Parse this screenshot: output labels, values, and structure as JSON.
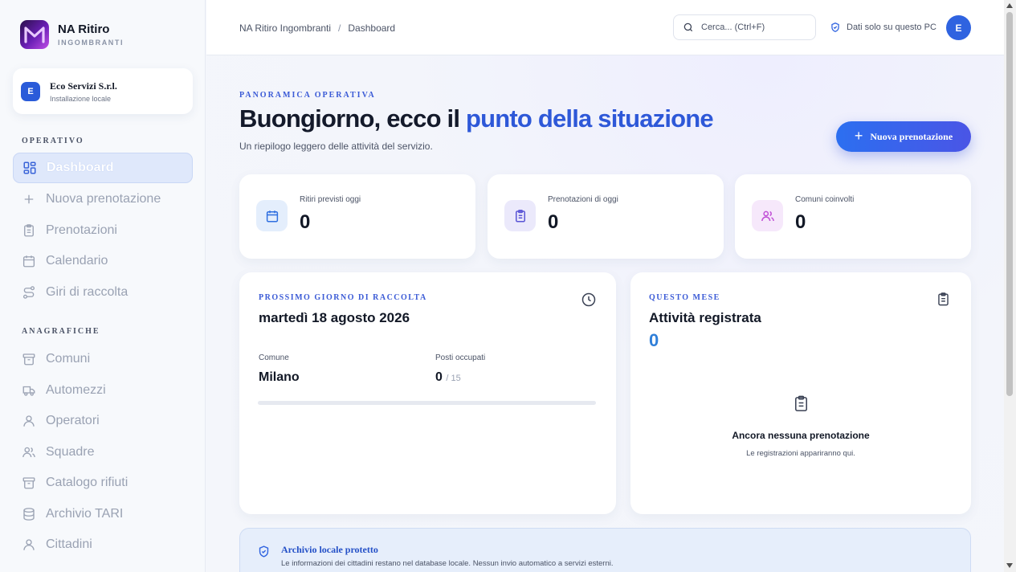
{
  "brand": {
    "title": "NA Ritiro",
    "subtitle": "INGOMBRANTI"
  },
  "org": {
    "avatar": "E",
    "name": "Eco Servizi S.r.l.",
    "subtitle": "Installazione locale"
  },
  "sidebar": {
    "section_operativo": "OPERATIVO",
    "section_anagrafiche": "ANAGRAFICHE",
    "operativo": [
      {
        "label": "Dashboard",
        "icon": "grid-icon",
        "active": true
      },
      {
        "label": "Nuova prenotazione",
        "icon": "plus-icon"
      },
      {
        "label": "Prenotazioni",
        "icon": "clipboard-icon"
      },
      {
        "label": "Calendario",
        "icon": "calendar-icon"
      },
      {
        "label": "Giri di raccolta",
        "icon": "route-icon"
      }
    ],
    "anagrafiche": [
      {
        "label": "Comuni",
        "icon": "archive-icon"
      },
      {
        "label": "Automezzi",
        "icon": "truck-icon"
      },
      {
        "label": "Operatori",
        "icon": "user-icon"
      },
      {
        "label": "Squadre",
        "icon": "users-icon"
      },
      {
        "label": "Catalogo rifiuti",
        "icon": "archive-icon"
      },
      {
        "label": "Archivio TARI",
        "icon": "database-icon"
      },
      {
        "label": "Cittadini",
        "icon": "user-icon"
      }
    ]
  },
  "topbar": {
    "breadcrumb_root": "NA Ritiro Ingombranti",
    "breadcrumb_sep": "/",
    "breadcrumb_current": "Dashboard",
    "search_placeholder": "Cerca... (Ctrl+F)",
    "local_note": "Dati solo su questo PC",
    "user_avatar": "E"
  },
  "hero": {
    "eyebrow": "PANORAMICA OPERATIVA",
    "title_part1": "Buongiorno, ecco il ",
    "title_part2": "punto della situazione",
    "subtitle": "Un riepilogo leggero delle attività del servizio.",
    "cta_plus": "+",
    "cta_label": "Nuova prenotazione"
  },
  "stats": [
    {
      "label": "Ritiri previsti oggi",
      "value": "0",
      "icon": "calendar-icon",
      "color": "#2f6fe0"
    },
    {
      "label": "Prenotazioni di oggi",
      "value": "0",
      "icon": "clipboard-icon",
      "color": "#5a55d6"
    },
    {
      "label": "Comuni coinvolti",
      "value": "0",
      "icon": "users-icon",
      "color": "#c04fd6"
    }
  ],
  "next_day": {
    "eyebrow": "PROSSIMO GIORNO DI RACCOLTA",
    "date": "martedì 18 agosto 2026",
    "comune_label": "Comune",
    "comune_value": "Milano",
    "posti_label": "Posti occupati",
    "posti_value": "0",
    "posti_total": "/ 15",
    "progress": 0
  },
  "month": {
    "eyebrow": "QUESTO MESE",
    "title": "Attività registrata",
    "value": "0",
    "empty_title": "Ancora nessuna prenotazione",
    "empty_sub": "Le registrazioni appariranno qui."
  },
  "archive_note": {
    "title": "Archivio locale protetto",
    "text": "Le informazioni dei cittadini restano nel database locale. Nessun invio automatico a servizi esterni."
  },
  "colors": {
    "accent": "#2e58d8",
    "primary": "#3a64d8",
    "brand_purple": "#6a1fb5"
  }
}
